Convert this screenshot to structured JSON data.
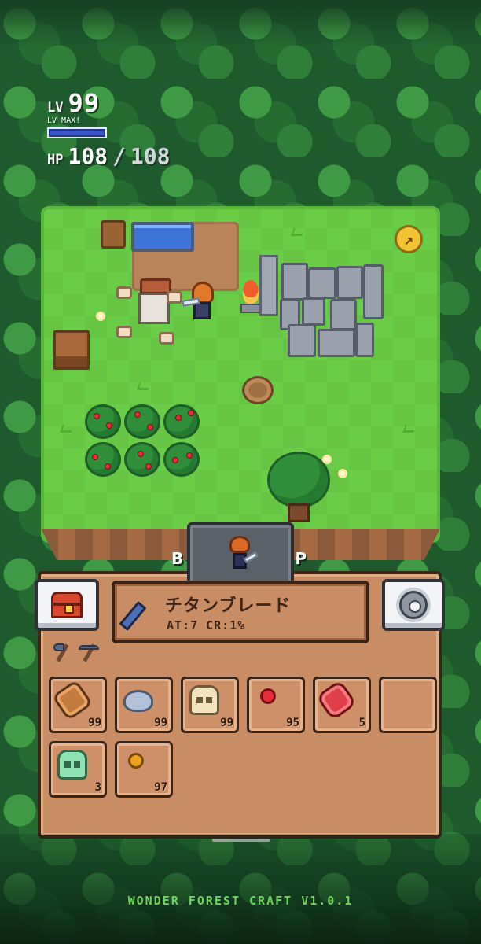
{
  "hud": {
    "level_label": "LV",
    "level": "99",
    "level_status": "LV MAX!",
    "xp_progress": 1.0,
    "hp_label": "HP",
    "hp_current": "108",
    "hp_separator": "/",
    "hp_max": "108"
  },
  "build_tab": {
    "left_letter": "B",
    "right_letter": "P"
  },
  "equipped_weapon": {
    "icon": "blade-icon",
    "name": "チタンブレード",
    "stats": "AT:7 CR:1%"
  },
  "tools": [
    "axe-icon",
    "pickaxe-icon"
  ],
  "inventory": [
    {
      "icon": "wood-log-icon",
      "count": "99"
    },
    {
      "icon": "stone-icon",
      "count": "99"
    },
    {
      "icon": "bone-skull-icon",
      "count": "99"
    },
    {
      "icon": "red-orb-icon",
      "count": "95"
    },
    {
      "icon": "raw-meat-icon",
      "count": "5"
    },
    {
      "icon": "",
      "count": ""
    },
    {
      "icon": "green-skull-icon",
      "count": "3"
    },
    {
      "icon": "orange-orb-icon",
      "count": "97"
    }
  ],
  "footer": {
    "version_text": "WONDER FOREST CRAFT V1.0.1"
  },
  "colors": {
    "grass": "#6acd47",
    "panel": "#c98d65",
    "footer_text": "#6fd15c",
    "xp_bar": "#3c57c9"
  }
}
